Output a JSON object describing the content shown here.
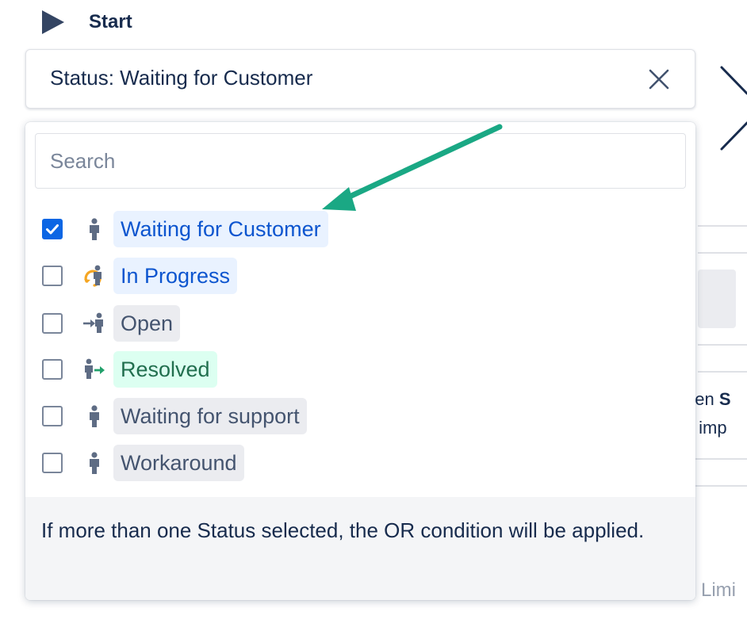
{
  "header": {
    "start_label": "Start"
  },
  "status_field": {
    "value_text": "Status: Waiting for Customer"
  },
  "dropdown": {
    "search_placeholder": "Search",
    "options": [
      {
        "label": "Waiting for Customer",
        "checked": true,
        "icon": "person-icon",
        "lozenge": "blue"
      },
      {
        "label": "In Progress",
        "checked": false,
        "icon": "person-progress-icon",
        "lozenge": "blue"
      },
      {
        "label": "Open",
        "checked": false,
        "icon": "person-enter-icon",
        "lozenge": "grey"
      },
      {
        "label": "Resolved",
        "checked": false,
        "icon": "person-exit-icon",
        "lozenge": "green"
      },
      {
        "label": "Waiting for support",
        "checked": false,
        "icon": "person-icon",
        "lozenge": "grey"
      },
      {
        "label": "Workaround",
        "checked": false,
        "icon": "person-icon",
        "lozenge": "grey"
      }
    ],
    "footer_text": "If more than one Status selected, the OR condition will be applied."
  },
  "background": {
    "partial_text_1a": "een ",
    "partial_text_1b": "S",
    "partial_text_2": "s imp",
    "partial_text_3": "Limi"
  },
  "colors": {
    "annotation_arrow": "#1aa884",
    "checkbox_checked": "#0c66e4",
    "lozenge_blue_text": "#0c55cf",
    "lozenge_green_text": "#216e4e",
    "lozenge_grey_text": "#44546f"
  }
}
